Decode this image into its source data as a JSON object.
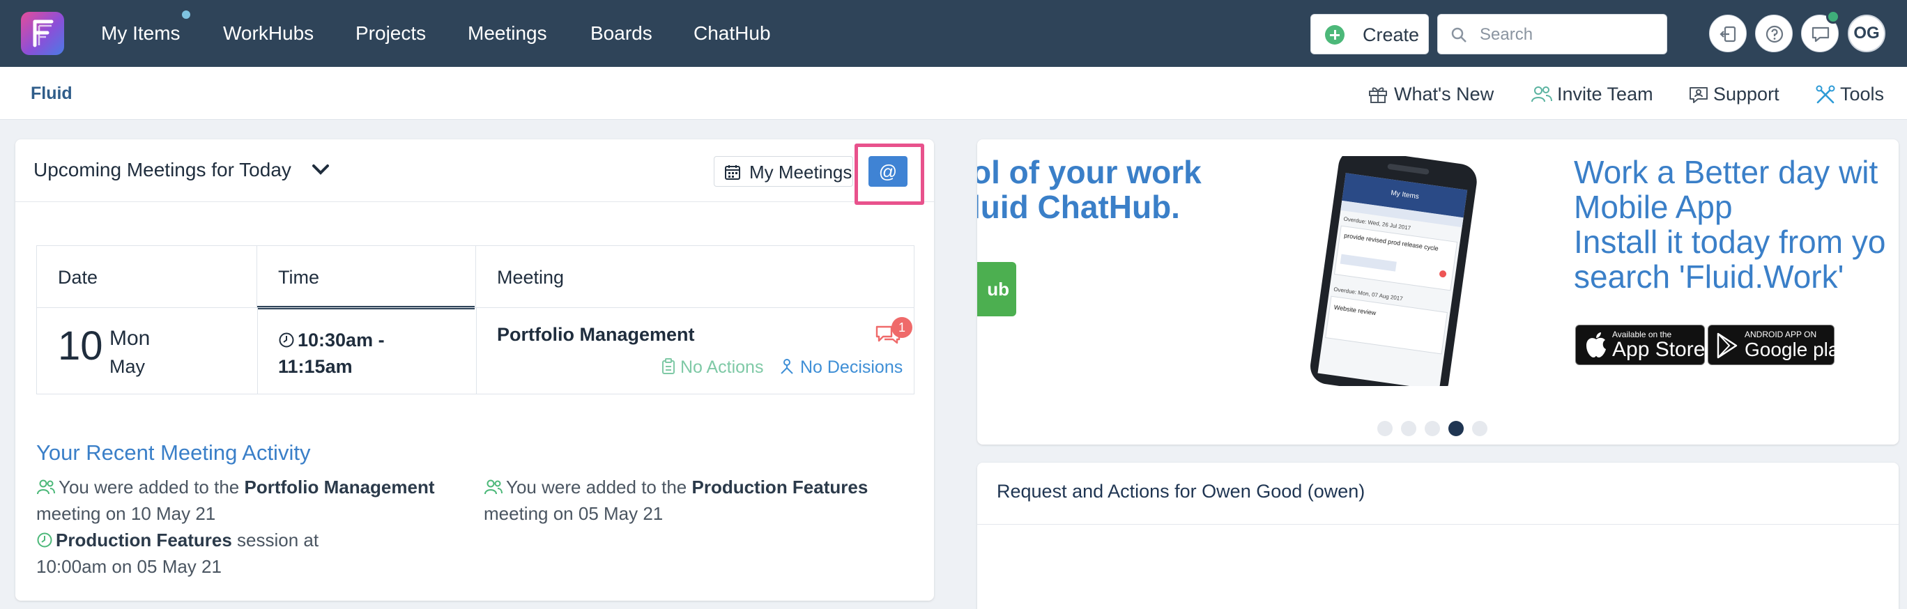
{
  "nav": {
    "items": [
      "My Items",
      "WorkHubs",
      "Projects",
      "Meetings",
      "Boards",
      "ChatHub"
    ],
    "create_label": "Create",
    "search_placeholder": "Search",
    "avatar_initials": "OG"
  },
  "subheader": {
    "brand": "Fluid",
    "links": [
      "What's New",
      "Invite Team",
      "Support",
      "Tools"
    ]
  },
  "meetings": {
    "title": "Upcoming Meetings for Today",
    "my_meetings_label": "My Meetings",
    "at_label": "@",
    "columns": [
      "Date",
      "Time",
      "Meeting"
    ],
    "rows": [
      {
        "day": "10",
        "weekday": "Mon",
        "month": "May",
        "time": "10:30am - 11:15am",
        "meeting": "Portfolio Management",
        "chat_count": "1",
        "actions": "No Actions",
        "decisions": "No Decisions"
      }
    ]
  },
  "recent": {
    "title": "Your Recent Meeting Activity",
    "activities": [
      {
        "pre": "You were added to the ",
        "bold": "Portfolio Management",
        "post": " meeting on 10 May 21"
      },
      {
        "pre": "You were added to the ",
        "bold": "Production Features",
        "post": " meeting on 05 May 21"
      },
      {
        "pre": "",
        "bold": "Production Features",
        "post": " session at 10:00am on 05 May 21"
      }
    ]
  },
  "banner": {
    "left_line1": "ol of your work",
    "left_line2": "luid ChatHub.",
    "left_button": "ub",
    "right_line1": "Work a Better day wit",
    "right_line2": "Mobile App",
    "right_line3": "Install it today from yo",
    "right_line4": "search 'Fluid.Work'",
    "appstore_small": "Available on the",
    "appstore_big": "App Store",
    "googleplay_small": "ANDROID APP ON",
    "googleplay_big": "Google play",
    "phone_header": "My Items",
    "phone_overdue1": "Overdue: Wed, 26 Jul 2017",
    "phone_task1": "provide revised prod release cycle",
    "phone_overdue2": "Overdue: Mon, 07 Aug 2017",
    "phone_task2": "Website review",
    "active_slide": 4,
    "slide_count": 5
  },
  "requests": {
    "title": "Request and Actions for Owen Good (owen)"
  },
  "colors": {
    "topbar": "#2f4459",
    "accent": "#3a7fc8",
    "highlight": "#e8528c",
    "success": "#4cb879"
  }
}
